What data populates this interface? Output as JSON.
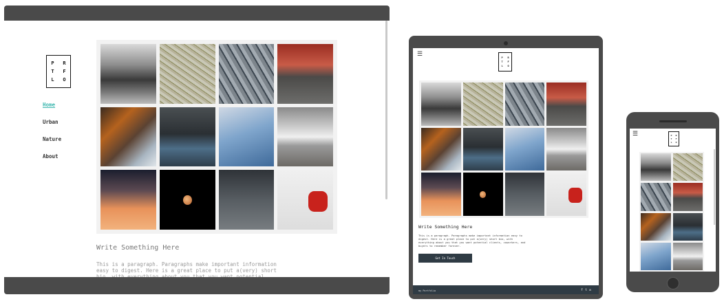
{
  "logo": {
    "letters": [
      "P",
      "R",
      "T",
      "F",
      "L",
      "O"
    ]
  },
  "nav": {
    "items": [
      "Home",
      "Urban",
      "Nature",
      "About"
    ],
    "active": "Home",
    "active_color": "#3fb8b0"
  },
  "content": {
    "heading": "Write Something Here",
    "paragraph": "This is a paragraph. Paragraphs make important information easy to digest. Here is a great place to put a(very) short bio, with everything about you that you want potential",
    "tablet_paragraph": "This is a paragraph. Paragraphs make important information easy to digest. Here is a great place to put a(very) short bio, with everything about you that you want potential clients, coworkers, and buyers to remember forever.",
    "button_label": "Get In Touch"
  },
  "footer": {
    "text": "my Portfolio",
    "icons": [
      "facebook-icon",
      "twitter-icon",
      "email-icon"
    ]
  },
  "colors": {
    "frame": "#4a4a4a",
    "footer_bg": "#2f3b44"
  },
  "photos": [
    "subway-bw",
    "tree-branches",
    "parking-lot-aerial",
    "red-brick-house",
    "rusty-chain",
    "canal-water",
    "fence-sky",
    "beach-clouds",
    "sunset-bird",
    "full-moon",
    "crane-clouds",
    "red-valve"
  ]
}
